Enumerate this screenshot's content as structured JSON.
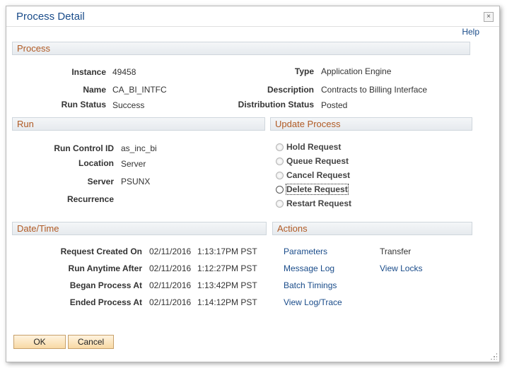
{
  "dialog": {
    "title": "Process Detail",
    "close_icon": "×",
    "help_link": "Help"
  },
  "process": {
    "header": "Process",
    "instance_label": "Instance",
    "instance_value": "49458",
    "type_label": "Type",
    "type_value": "Application Engine",
    "name_label": "Name",
    "name_value": "CA_BI_INTFC",
    "description_label": "Description",
    "description_value": "Contracts to Billing Interface",
    "run_status_label": "Run Status",
    "run_status_value": "Success",
    "distribution_status_label": "Distribution Status",
    "distribution_status_value": "Posted"
  },
  "run": {
    "header": "Run",
    "run_control_label": "Run Control ID",
    "run_control_value": "as_inc_bi",
    "location_label": "Location",
    "location_value": "Server",
    "server_label": "Server",
    "server_value": "PSUNX",
    "recurrence_label": "Recurrence",
    "recurrence_value": ""
  },
  "update_process": {
    "header": "Update Process",
    "options": [
      {
        "label": "Hold Request",
        "enabled": false
      },
      {
        "label": "Queue Request",
        "enabled": false
      },
      {
        "label": "Cancel Request",
        "enabled": false
      },
      {
        "label": "Delete Request",
        "enabled": true
      },
      {
        "label": "Restart Request",
        "enabled": false
      }
    ]
  },
  "datetime": {
    "header": "Date/Time",
    "rows": [
      {
        "label": "Request Created On",
        "date": "02/11/2016",
        "time": "1:13:17PM PST"
      },
      {
        "label": "Run Anytime After",
        "date": "02/11/2016",
        "time": "1:12:27PM PST"
      },
      {
        "label": "Began Process At",
        "date": "02/11/2016",
        "time": "1:13:42PM PST"
      },
      {
        "label": "Ended Process At",
        "date": "02/11/2016",
        "time": "1:14:12PM PST"
      }
    ]
  },
  "actions": {
    "header": "Actions",
    "parameters": "Parameters",
    "transfer": "Transfer",
    "message_log": "Message Log",
    "view_locks": "View Locks",
    "batch_timings": "Batch Timings",
    "view_log_trace": "View Log/Trace"
  },
  "buttons": {
    "ok": "OK",
    "cancel": "Cancel"
  },
  "colors": {
    "link": "#1a4c8a",
    "section_header_text": "#b05a24",
    "button_fill": "#f8d9a4"
  }
}
